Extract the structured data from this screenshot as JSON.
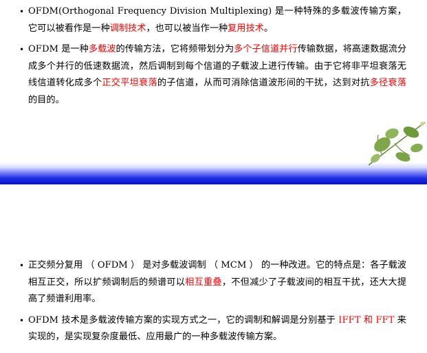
{
  "slide1": {
    "items": [
      {
        "segments": [
          {
            "text": "OFDM(Orthogonal Frequency Division Multiplexing) 是一种特殊的多载波传输方案，它可以被看作是一种",
            "hl": false
          },
          {
            "text": "调制技术",
            "hl": true
          },
          {
            "text": "，也可以被当作一种",
            "hl": false
          },
          {
            "text": "复用技术",
            "hl": true
          },
          {
            "text": "。",
            "hl": false
          }
        ]
      },
      {
        "segments": [
          {
            "text": "OFDM 是一种",
            "hl": false
          },
          {
            "text": "多载波",
            "hl": true
          },
          {
            "text": "的传输方法，它将频带划分为",
            "hl": false
          },
          {
            "text": "多个子信道并行",
            "hl": true
          },
          {
            "text": "传输数据，将高速数据流分成多个并行的低速数据流，然后调制到每个信道的子载波上进行传输。由于它将非平坦衰落无线信道转化成多个",
            "hl": false
          },
          {
            "text": "正交平坦衰落",
            "hl": true
          },
          {
            "text": "的子信道，从而可消除信道波形间的干扰，达到对抗",
            "hl": false
          },
          {
            "text": "多径衰落",
            "hl": true
          },
          {
            "text": "的目的。",
            "hl": false
          }
        ]
      }
    ]
  },
  "slide2": {
    "items": [
      {
        "segments": [
          {
            "text": "正交频分复用 （ OFDM ） 是对多载波调制 （ MCM ） 的一种改进。它的特点是：各子载波相互正交，所以扩频调制后的频谱可以",
            "hl": false
          },
          {
            "text": "相互重叠",
            "hl": true
          },
          {
            "text": "，不但减少了子载波间的相互干扰，还大大提高了频谱利用率。",
            "hl": false
          }
        ]
      },
      {
        "segments": [
          {
            "text": "OFDM 技术是多载波传输方案的实现方式之一，它的调制和解调是分别基于 ",
            "hl": false
          },
          {
            "text": "IFFT 和 FFT",
            "hl": true
          },
          {
            "text": " 来实现的，是实现复杂度最低、应用最广的一种多载波传输方案。",
            "hl": false
          }
        ]
      }
    ]
  },
  "colors": {
    "highlight": "#ff0000",
    "band": "#0a14c8",
    "text": "#000000"
  }
}
